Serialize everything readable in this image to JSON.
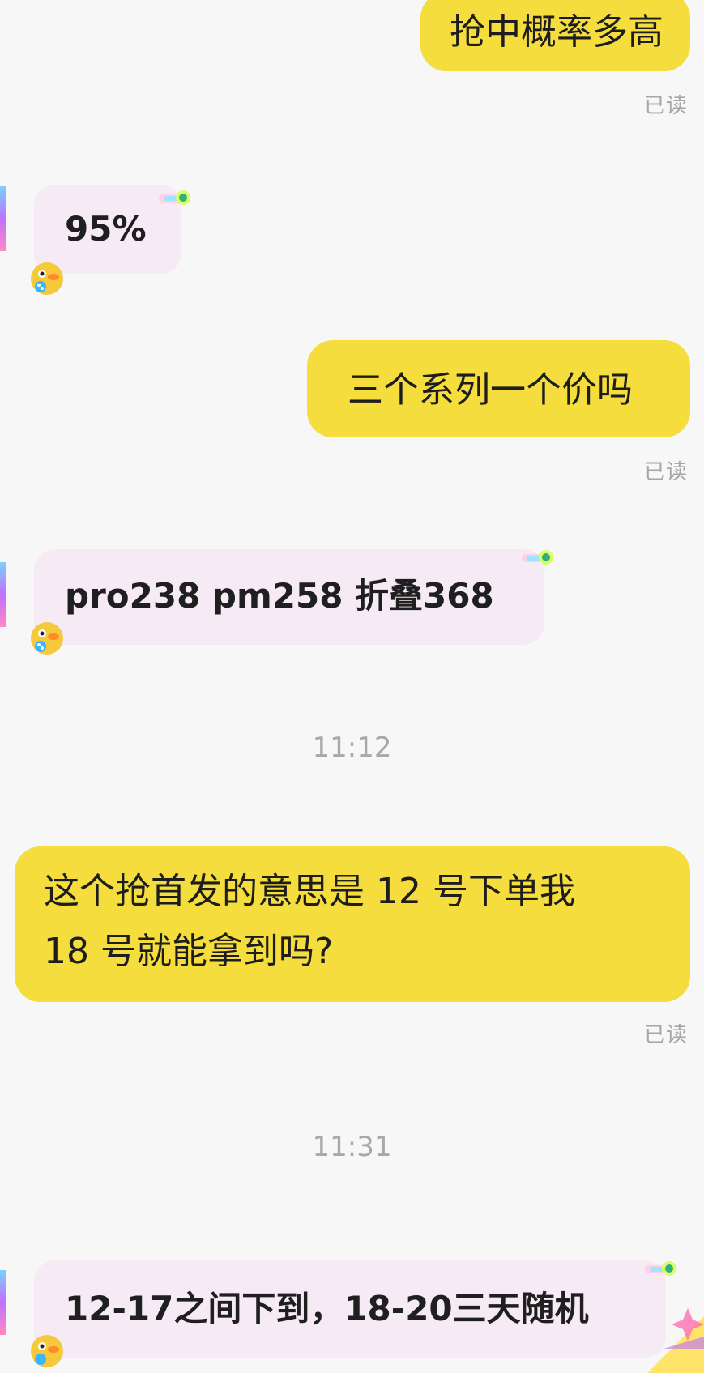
{
  "messages": {
    "m1": {
      "text": "抢中概率多高",
      "read": "已读"
    },
    "m2": {
      "text": "95%"
    },
    "m3": {
      "text": "三个系列一个价吗",
      "read": "已读"
    },
    "m4": {
      "text": "pro238 pm258 折叠368"
    },
    "t1": {
      "text": "11:12"
    },
    "m5": {
      "line1": "这个抢首发的意思是 12 号下单我",
      "line2": "18 号就能拿到吗?",
      "read": "已读"
    },
    "t2": {
      "text": "11:31"
    },
    "m6": {
      "text": "12-17之间下到，18-20三天随机"
    }
  },
  "colors": {
    "outgoing_bubble": "#f4dd3d",
    "incoming_bubble": "#f6eaf5",
    "background": "#f7f7f7",
    "meta_text": "#a6a6a6"
  },
  "icons": [
    "bubble-badge-icon",
    "mascot-avatar-icon"
  ]
}
